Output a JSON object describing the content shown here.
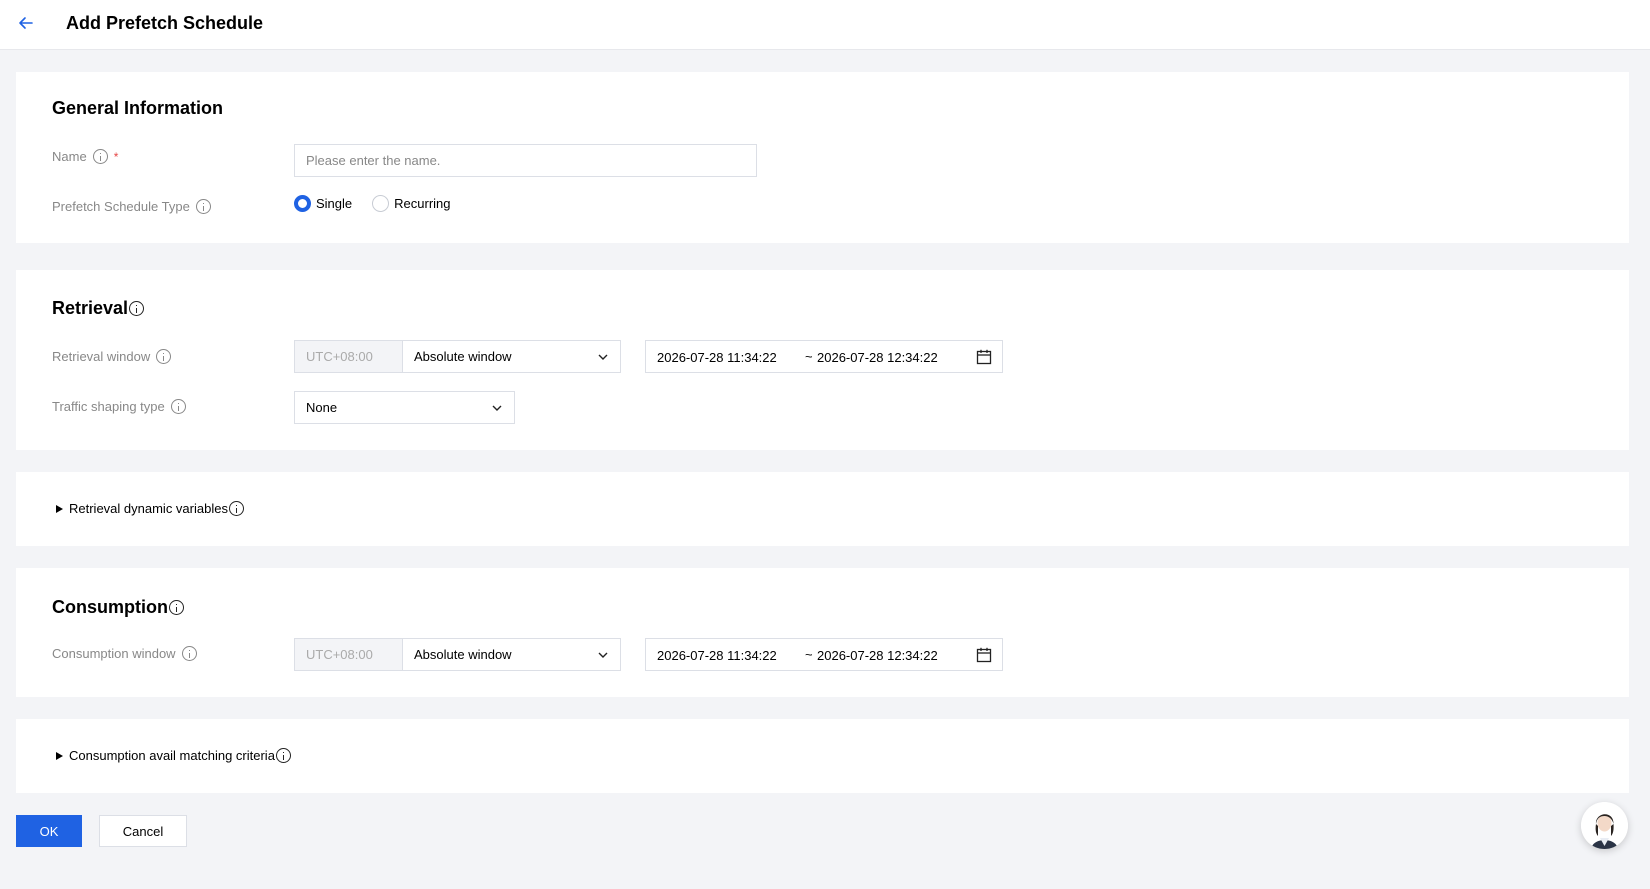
{
  "header": {
    "title": "Add Prefetch Schedule"
  },
  "general": {
    "title": "General Information",
    "name_label": "Name",
    "required_mark": "*",
    "name_placeholder": "Please enter the name.",
    "type_label": "Prefetch Schedule Type",
    "type_options": [
      "Single",
      "Recurring"
    ],
    "type_selected": "Single"
  },
  "retrieval": {
    "title": "Retrieval",
    "window_label": "Retrieval window",
    "timezone": "UTC+08:00",
    "window_mode": "Absolute window",
    "range_from": "2026-07-28 11:34:22",
    "range_separator": "~",
    "range_to": "2026-07-28 12:34:22",
    "shaping_label": "Traffic shaping type",
    "shaping_value": "None"
  },
  "retrieval_dynamic": {
    "label": "Retrieval dynamic variables"
  },
  "consumption": {
    "title": "Consumption",
    "window_label": "Consumption window",
    "timezone": "UTC+08:00",
    "window_mode": "Absolute window",
    "range_from": "2026-07-28 11:34:22",
    "range_separator": "~",
    "range_to": "2026-07-28 12:34:22"
  },
  "consumption_avail": {
    "label": "Consumption avail matching criteria"
  },
  "footer": {
    "ok_label": "OK",
    "cancel_label": "Cancel"
  },
  "colors": {
    "primary": "#1f62e3",
    "background": "#f3f4f7",
    "required": "#e54545"
  },
  "icons": {
    "back": "arrow-left-icon",
    "info": "info-icon",
    "calendar": "calendar-icon",
    "chevron": "chevron-down-icon",
    "assistant": "assistant-avatar"
  }
}
